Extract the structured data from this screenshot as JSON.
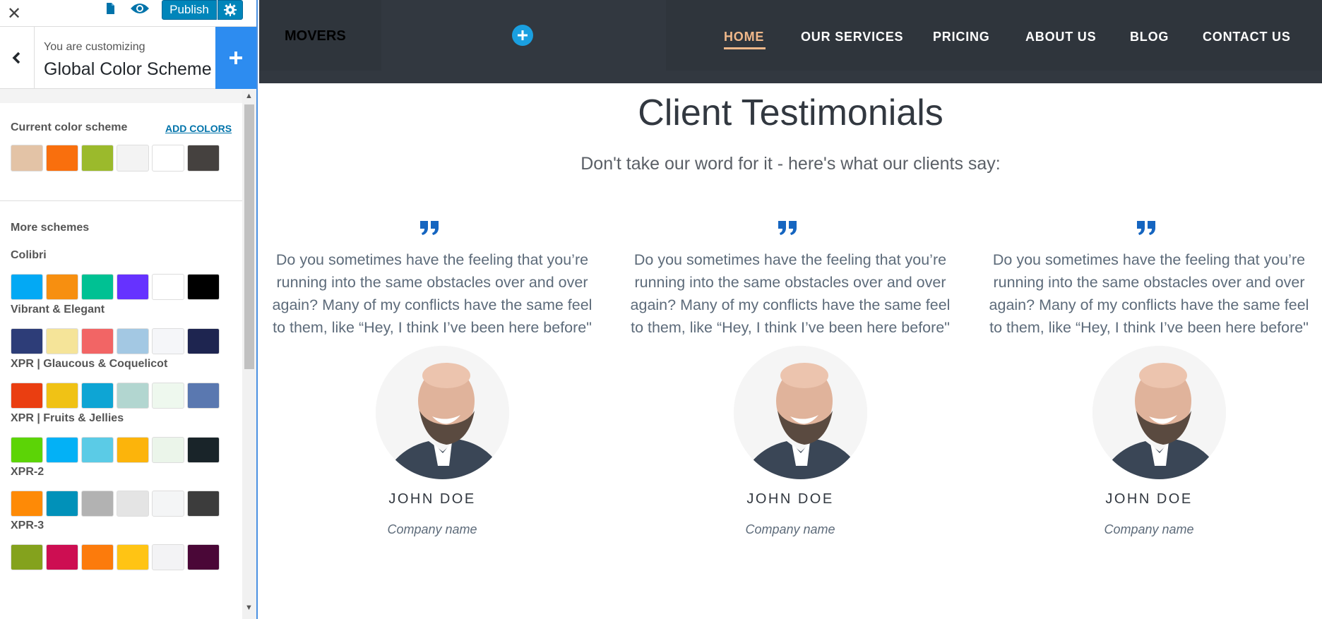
{
  "toolbar": {
    "close_icon": "close-icon",
    "doc_icon": "document-icon",
    "eye_icon": "eye-icon",
    "publish_label": "Publish",
    "gear_icon": "gear-icon"
  },
  "customizer": {
    "subtitle": "You are customizing",
    "title": "Global Color Scheme"
  },
  "current_scheme": {
    "label": "Current color scheme",
    "add_colors": "ADD COLORS",
    "colors": [
      "#e3c3a6",
      "#f96f0d",
      "#9bba2c",
      "#f3f3f3",
      "#ffffff",
      "#45413f"
    ]
  },
  "more_schemes": {
    "label": "More schemes",
    "schemes": [
      {
        "name": "Colibri",
        "colors": [
          "#03a9f4",
          "#f78f10",
          "#00c193",
          "#6632ff",
          "#ffffff",
          "#000000"
        ]
      },
      {
        "name": "Vibrant & Elegant",
        "colors": [
          "#2d3d78",
          "#f5e499",
          "#f26565",
          "#a3c8e3",
          "#f5f6f9",
          "#1e2550"
        ]
      },
      {
        "name": "XPR | Glaucous & Coquelicot",
        "colors": [
          "#ea3e11",
          "#f0c215",
          "#0ea5d4",
          "#b2d6d0",
          "#eef8ee",
          "#5a78b0"
        ]
      },
      {
        "name": "XPR | Fruits & Jellies",
        "colors": [
          "#5cd406",
          "#03b1f6",
          "#5bcbe6",
          "#fcb40b",
          "#ebf5ea",
          "#192429"
        ]
      },
      {
        "name": "XPR-2",
        "colors": [
          "#fe8a06",
          "#0191b9",
          "#b2b2b2",
          "#e4e4e4",
          "#f4f5f6",
          "#3c3c3c"
        ]
      },
      {
        "name": "XPR-3",
        "colors": [
          "#84a21d",
          "#cd0e52",
          "#fc7b0c",
          "#ffc414",
          "#f3f3f5",
          "#4a0737"
        ]
      }
    ]
  },
  "site": {
    "logo": "MOVERS",
    "nav": [
      "HOME",
      "OUR SERVICES",
      "PRICING",
      "ABOUT US",
      "BLOG",
      "CONTACT US"
    ],
    "heading": "Client Testimonials",
    "subheading": "Don't take our word for it - here's what our clients say:",
    "testimonials": [
      {
        "quote": "Do you sometimes have the feeling that you’re running into the same obstacles over and over again? Many of my conflicts have the same feel to them, like “Hey, I think I’ve been here before\"",
        "name": "JOHN DOE",
        "company": "Company name"
      },
      {
        "quote": "Do you sometimes have the feeling that you’re running into the same obstacles over and over again? Many of my conflicts have the same feel to them, like “Hey, I think I’ve been here before\"",
        "name": "JOHN DOE",
        "company": "Company name"
      },
      {
        "quote": "Do you sometimes have the feeling that you’re running into the same obstacles over and over again? Many of my conflicts have the same feel to them, like “Hey, I think I’ve been here before\"",
        "name": "JOHN DOE",
        "company": "Company name"
      }
    ]
  },
  "colors": {
    "accent": "#0085ba",
    "nav_bg": "#323840",
    "active_nav": "#f0b88a",
    "quote_icon": "#1565c0"
  }
}
